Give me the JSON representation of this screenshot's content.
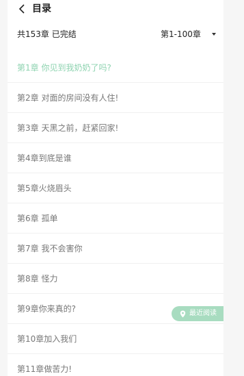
{
  "header": {
    "title": "目录",
    "back_icon": "chevron-left-icon"
  },
  "summary": {
    "text": "共153章 已完结"
  },
  "range_select": {
    "selected": "第1-100章",
    "icon": "caret-down-icon"
  },
  "chapters": [
    {
      "label": "第1章 你见到我奶奶了吗?",
      "active": true
    },
    {
      "label": "第2章 对面的房间没有人住!"
    },
    {
      "label": "第3章 天黑之前，赶紧回家!"
    },
    {
      "label": "第4章到底是谁"
    },
    {
      "label": "第5章火烧眉头"
    },
    {
      "label": "第6章 孤单"
    },
    {
      "label": "第7章 我不会害你"
    },
    {
      "label": "第8章 怪力"
    },
    {
      "label": "第9章你来真的?"
    },
    {
      "label": "第10章加入我们"
    },
    {
      "label": "第11章做苦力!"
    }
  ],
  "recent_button": {
    "label": "最近阅读",
    "icon": "location-pin-icon"
  },
  "colors": {
    "accent": "#8ed3b0",
    "recent_button_bg": "#a8dcc0",
    "panel_bg": "#ffffff",
    "page_bg": "#f6f6f6"
  }
}
